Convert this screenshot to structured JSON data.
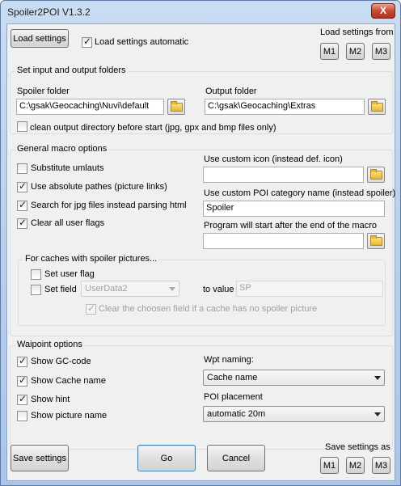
{
  "window": {
    "title": "Spoiler2POI V1.3.2",
    "close_glyph": "X"
  },
  "top": {
    "load_settings": "Load settings",
    "load_auto": "Load settings automatic",
    "load_from": "Load settings from",
    "m1": "M1",
    "m2": "M2",
    "m3": "M3"
  },
  "folders": {
    "group_title": "Set input and output folders",
    "spoiler_label": "Spoiler folder",
    "spoiler_value": "C:\\gsak\\Geocaching\\Nuvi\\default",
    "output_label": "Output folder",
    "output_value": "C:\\gsak\\Geocaching\\Extras",
    "clean_label": "clean output directory before start (jpg, gpx and bmp files only)"
  },
  "macro": {
    "group_title": "General macro options",
    "substitute": "Substitute umlauts",
    "absolute": "Use absolute pathes (picture links)",
    "search_jpg": "Search for jpg files instead parsing html",
    "clear_flags": "Clear all user flags",
    "custom_icon_label": "Use custom icon (instead def. icon)",
    "custom_icon_value": "",
    "custom_cat_label": "Use custom POI category name (instead spoiler)",
    "custom_cat_value": "Spoiler",
    "program_label": "Program will start after the end of the macro",
    "program_value": ""
  },
  "caches": {
    "group_title": "For caches with spoiler pictures...",
    "set_user_flag": "Set user flag",
    "set_field": "Set field",
    "field_value": "UserData2",
    "to_value_label": "to value",
    "to_value": "SP",
    "clear_field": "Clear the choosen field if a cache has no spoiler picture"
  },
  "waypoint": {
    "group_title": "Waipoint options",
    "show_gc": "Show GC-code",
    "show_name": "Show Cache name",
    "show_hint": "Show hint",
    "show_pic": "Show picture name",
    "naming_label": "Wpt naming:",
    "naming_value": "Cache name",
    "placement_label": "POI placement",
    "placement_value": "automatic 20m"
  },
  "bottom": {
    "save_settings": "Save settings",
    "go": "Go",
    "cancel": "Cancel",
    "save_as": "Save settings as",
    "m1": "M1",
    "m2": "M2",
    "m3": "M3"
  }
}
